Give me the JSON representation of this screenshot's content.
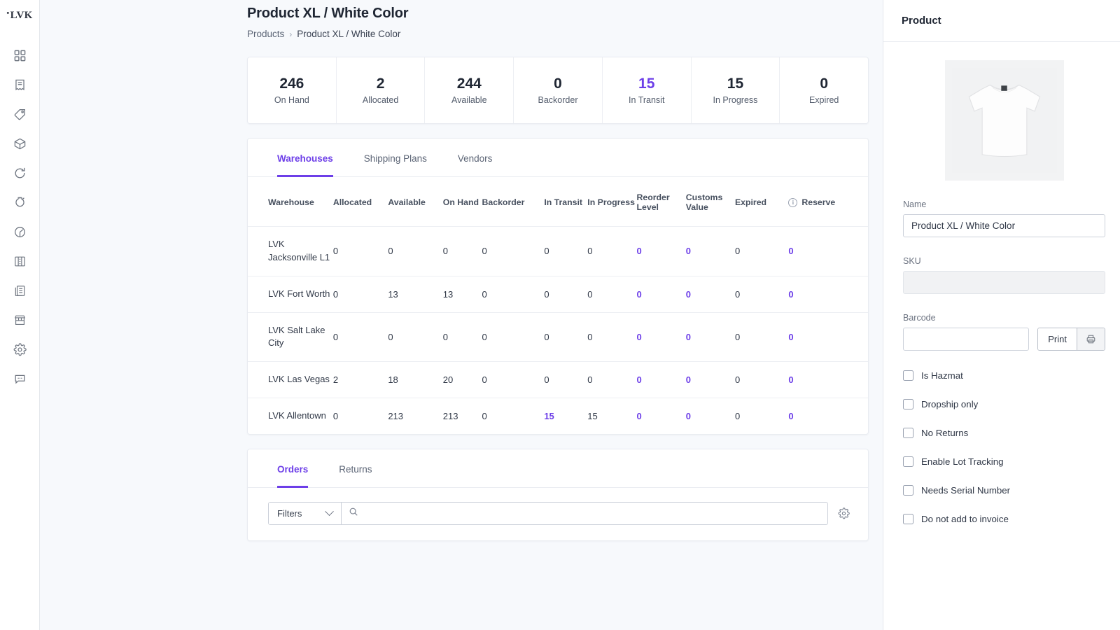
{
  "brand": {
    "logo_text": "LVK",
    "accent": "#6d3fe8"
  },
  "sidebar": {
    "items": [
      {
        "name": "dashboard",
        "icon": "grid-icon"
      },
      {
        "name": "orders",
        "icon": "receipt-icon"
      },
      {
        "name": "products",
        "icon": "tag-icon"
      },
      {
        "name": "inventory",
        "icon": "box-icon"
      },
      {
        "name": "returns",
        "icon": "refresh-icon"
      },
      {
        "name": "fulfillment",
        "icon": "shipping-icon"
      },
      {
        "name": "analytics",
        "icon": "pie-chart-icon"
      },
      {
        "name": "warehouses",
        "icon": "building-icon"
      },
      {
        "name": "reports",
        "icon": "documents-icon"
      },
      {
        "name": "stores",
        "icon": "store-icon"
      },
      {
        "name": "settings",
        "icon": "gear-icon"
      },
      {
        "name": "support",
        "icon": "chat-icon"
      }
    ]
  },
  "header": {
    "title": "Product XL / White Color",
    "breadcrumb": {
      "root": "Products",
      "separator": "›",
      "current": "Product XL / White Color"
    }
  },
  "stats": [
    {
      "value": "246",
      "label": "On Hand",
      "accent": false
    },
    {
      "value": "2",
      "label": "Allocated",
      "accent": false
    },
    {
      "value": "244",
      "label": "Available",
      "accent": false
    },
    {
      "value": "0",
      "label": "Backorder",
      "accent": false
    },
    {
      "value": "15",
      "label": "In Transit",
      "accent": true
    },
    {
      "value": "15",
      "label": "In Progress",
      "accent": false
    },
    {
      "value": "0",
      "label": "Expired",
      "accent": false
    }
  ],
  "inventory_panel": {
    "tabs": [
      {
        "label": "Warehouses",
        "active": true
      },
      {
        "label": "Shipping Plans",
        "active": false
      },
      {
        "label": "Vendors",
        "active": false
      }
    ],
    "columns": [
      "Warehouse",
      "Allocated",
      "Available",
      "On Hand",
      "Backorder",
      "In Transit",
      "In Progress",
      "Reorder Level",
      "Customs Value",
      "Expired",
      "Reserve"
    ],
    "reserve_info_icon": "i",
    "rows": [
      {
        "warehouse": "LVK Jacksonville L1",
        "allocated": "0",
        "available": "0",
        "on_hand": "0",
        "backorder": "0",
        "in_transit": "0",
        "in_progress": "0",
        "reorder_level": "0",
        "customs_value": "0",
        "expired": "0",
        "reserve": "0"
      },
      {
        "warehouse": "LVK Fort Worth",
        "allocated": "0",
        "available": "13",
        "on_hand": "13",
        "backorder": "0",
        "in_transit": "0",
        "in_progress": "0",
        "reorder_level": "0",
        "customs_value": "0",
        "expired": "0",
        "reserve": "0"
      },
      {
        "warehouse": "LVK Salt Lake City",
        "allocated": "0",
        "available": "0",
        "on_hand": "0",
        "backorder": "0",
        "in_transit": "0",
        "in_progress": "0",
        "reorder_level": "0",
        "customs_value": "0",
        "expired": "0",
        "reserve": "0"
      },
      {
        "warehouse": "LVK Las Vegas",
        "allocated": "2",
        "available": "18",
        "on_hand": "20",
        "backorder": "0",
        "in_transit": "0",
        "in_progress": "0",
        "reorder_level": "0",
        "customs_value": "0",
        "expired": "0",
        "reserve": "0"
      },
      {
        "warehouse": "LVK Allentown",
        "allocated": "0",
        "available": "213",
        "on_hand": "213",
        "backorder": "0",
        "in_transit": "15",
        "in_progress": "15",
        "reorder_level": "0",
        "customs_value": "0",
        "expired": "0",
        "reserve": "0"
      }
    ]
  },
  "orders_panel": {
    "tabs": [
      {
        "label": "Orders",
        "active": true
      },
      {
        "label": "Returns",
        "active": false
      }
    ],
    "filters_label": "Filters",
    "search_value": "",
    "search_placeholder": "",
    "settings_icon": "gear-icon"
  },
  "product_panel": {
    "title": "Product",
    "image_alt": "white t-shirt product photo",
    "name_label": "Name",
    "name_value": "Product XL / White Color",
    "sku_label": "SKU",
    "sku_value": "",
    "barcode_label": "Barcode",
    "barcode_value": "",
    "print_label": "Print",
    "checkboxes": [
      {
        "label": "Is Hazmat",
        "checked": false
      },
      {
        "label": "Dropship only",
        "checked": false
      },
      {
        "label": "No Returns",
        "checked": false
      },
      {
        "label": "Enable Lot Tracking",
        "checked": false
      },
      {
        "label": "Needs Serial Number",
        "checked": false
      },
      {
        "label": "Do not add to invoice",
        "checked": false
      }
    ]
  }
}
